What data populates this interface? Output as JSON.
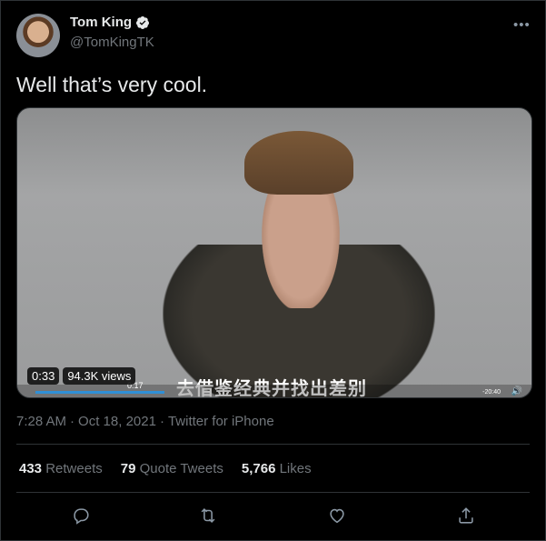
{
  "user": {
    "name": "Tom King",
    "handle": "@TomKingTK",
    "verified": true
  },
  "more_label": "•••",
  "tweet": {
    "text": "Well that’s very cool."
  },
  "media": {
    "time": "0:33",
    "views": "94.3K views",
    "subtitle": "去借鉴经典并找出差别",
    "inner_timestamp": "0:17",
    "inner_remaining": "-20:40",
    "inner_progress": 0.25
  },
  "meta": {
    "time": "7:28 AM",
    "date": "Oct 18, 2021",
    "separator": "·",
    "source": "Twitter for iPhone"
  },
  "stats": {
    "retweets_count": "433",
    "retweets_label": "Retweets",
    "quotes_count": "79",
    "quotes_label": "Quote Tweets",
    "likes_count": "5,766",
    "likes_label": "Likes"
  },
  "icons": {
    "reply": "reply-icon",
    "retweet": "retweet-icon",
    "like": "heart-icon",
    "share": "share-icon",
    "verified": "verified-badge-icon",
    "more": "more-icon"
  },
  "colors": {
    "background": "#000000",
    "text": "#e7e9ea",
    "secondary": "#71767b",
    "border": "#2f3336",
    "accent": "#1d9bf0"
  }
}
